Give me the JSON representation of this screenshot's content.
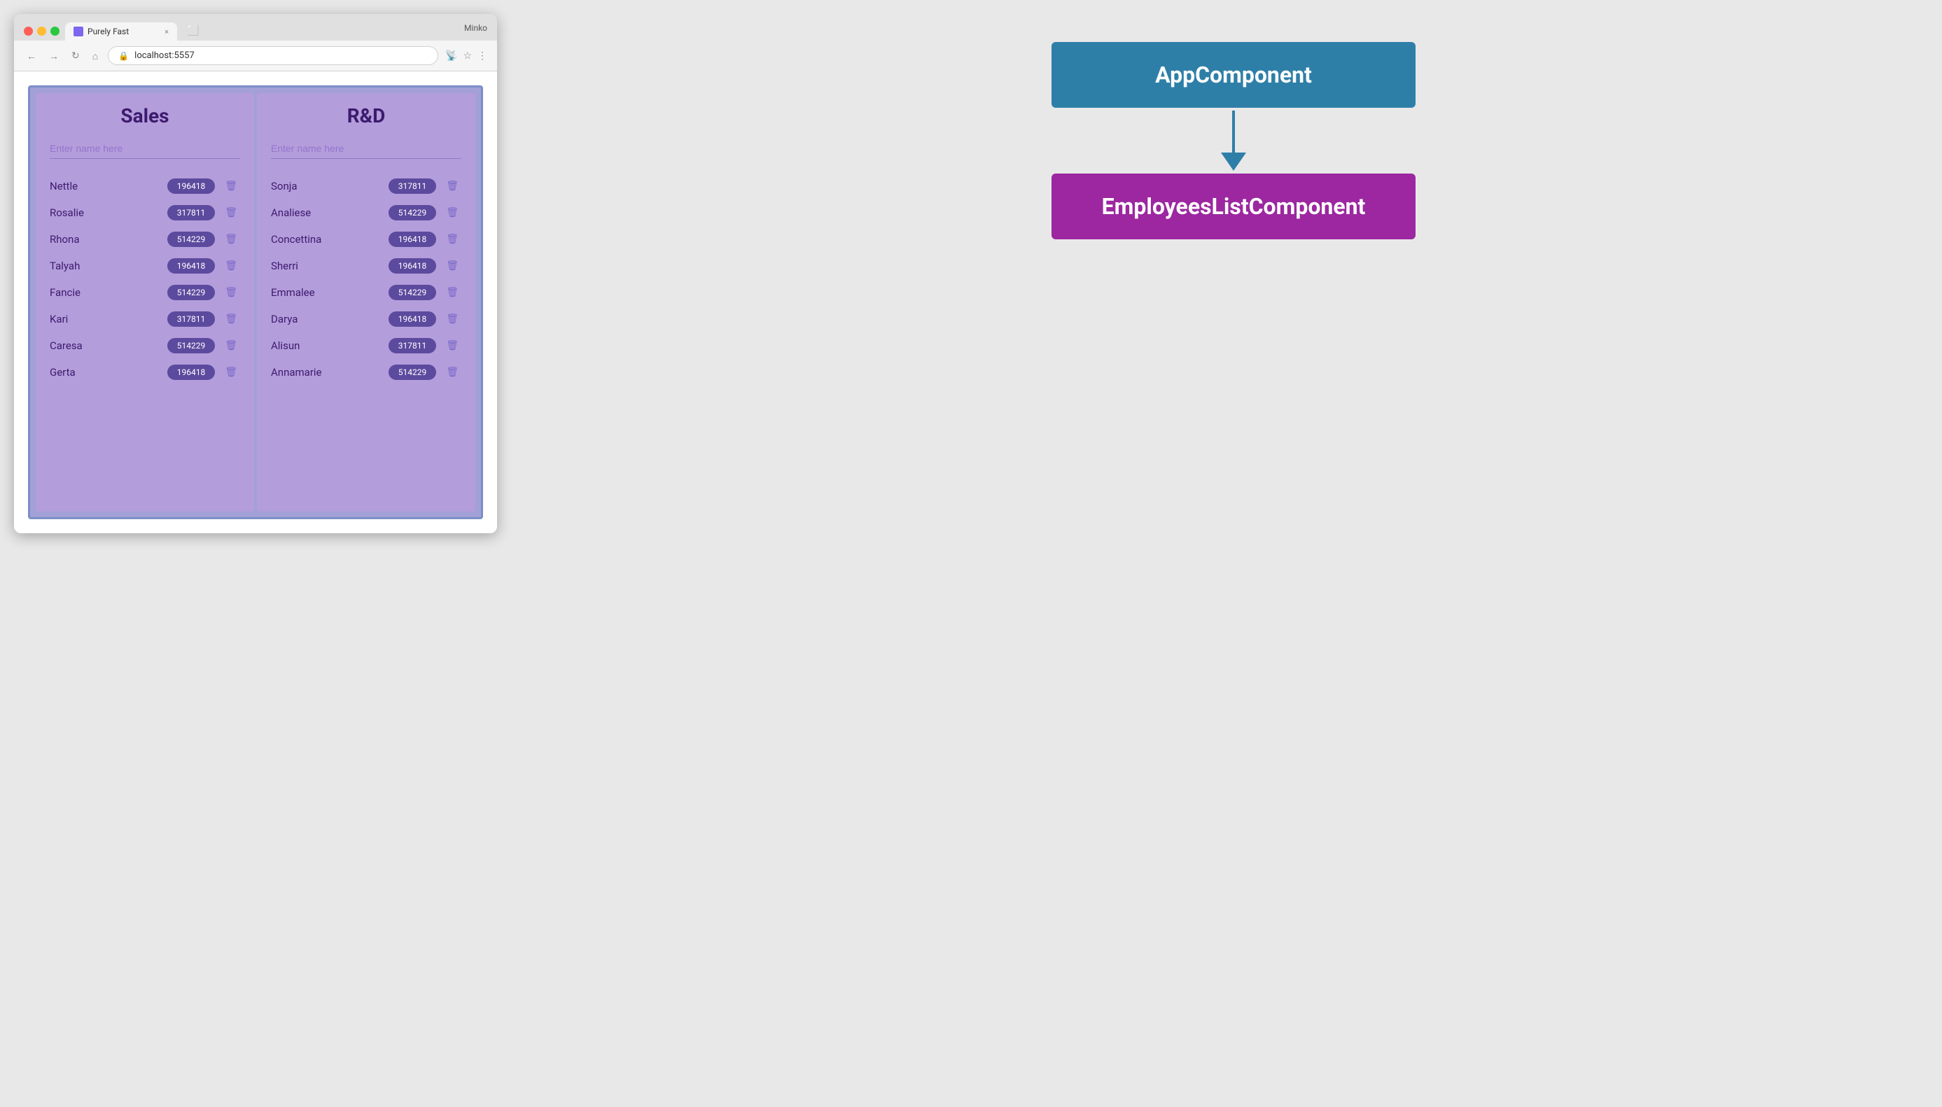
{
  "browser": {
    "title": "Purely Fast",
    "url": "localhost:5557",
    "tab_label": "Purely Fast",
    "user": "Minko",
    "close_label": "×"
  },
  "app": {
    "sales": {
      "title": "Sales",
      "input_placeholder": "Enter name here",
      "employees": [
        {
          "name": "Nettle",
          "badge": "196418"
        },
        {
          "name": "Rosalie",
          "badge": "317811"
        },
        {
          "name": "Rhona",
          "badge": "514229"
        },
        {
          "name": "Talyah",
          "badge": "196418"
        },
        {
          "name": "Fancie",
          "badge": "514229"
        },
        {
          "name": "Kari",
          "badge": "317811"
        },
        {
          "name": "Caresa",
          "badge": "514229"
        },
        {
          "name": "Gerta",
          "badge": "196418"
        }
      ]
    },
    "rnd": {
      "title": "R&D",
      "input_placeholder": "Enter name here",
      "employees": [
        {
          "name": "Sonja",
          "badge": "317811"
        },
        {
          "name": "Analiese",
          "badge": "514229"
        },
        {
          "name": "Concettina",
          "badge": "196418"
        },
        {
          "name": "Sherri",
          "badge": "196418"
        },
        {
          "name": "Emmalee",
          "badge": "514229"
        },
        {
          "name": "Darya",
          "badge": "196418"
        },
        {
          "name": "Alisun",
          "badge": "317811"
        },
        {
          "name": "Annamarie",
          "badge": "514229"
        }
      ]
    }
  },
  "diagram": {
    "app_component_label": "AppComponent",
    "employees_component_label": "EmployeesListComponent"
  }
}
